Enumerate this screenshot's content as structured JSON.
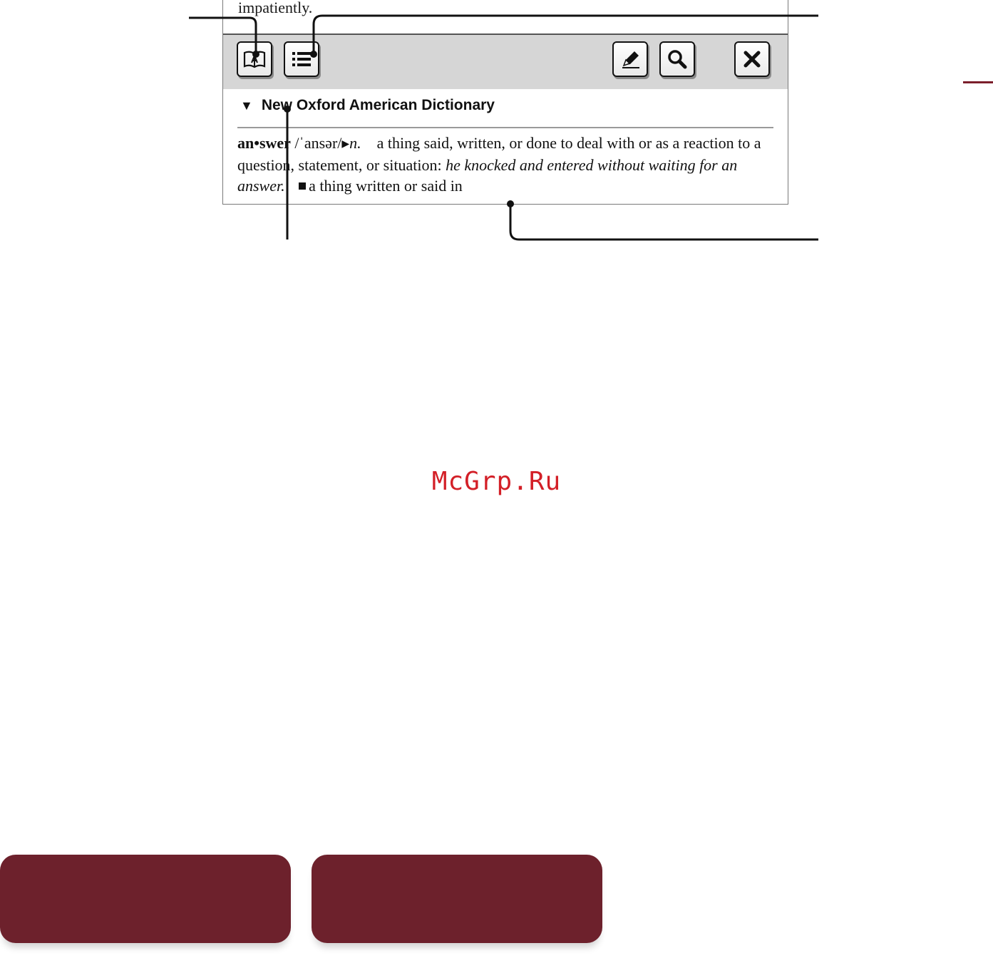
{
  "screen": {
    "previous_text": "impatiently.",
    "toolbar": {
      "buttons": [
        {
          "name": "dictionary-book-button",
          "icon": "open-book-icon"
        },
        {
          "name": "list-button",
          "icon": "list-icon"
        },
        {
          "name": "pen-button",
          "icon": "pencil-icon"
        },
        {
          "name": "search-button",
          "icon": "magnifier-icon"
        },
        {
          "name": "close-button",
          "icon": "close-icon"
        }
      ]
    },
    "dictionary": {
      "collapse_glyph": "▼",
      "name": "New Oxford American Dictionary"
    },
    "entry": {
      "headword": "an•swer",
      "pronunciation": "/ˈansər/",
      "pos_marker": "▶",
      "pos": "n.",
      "definition1": "a thing said, written, or done to deal with or as a reaction to a question, statement, or situation:",
      "example": "he knocked and entered without waiting for an answer.",
      "definition2": "a thing written or said in"
    }
  },
  "watermark": "McGrp.Ru",
  "colors": {
    "accent": "#6d212c",
    "watermark": "#d31f27",
    "toolbar_bg": "#d6d6d6"
  }
}
